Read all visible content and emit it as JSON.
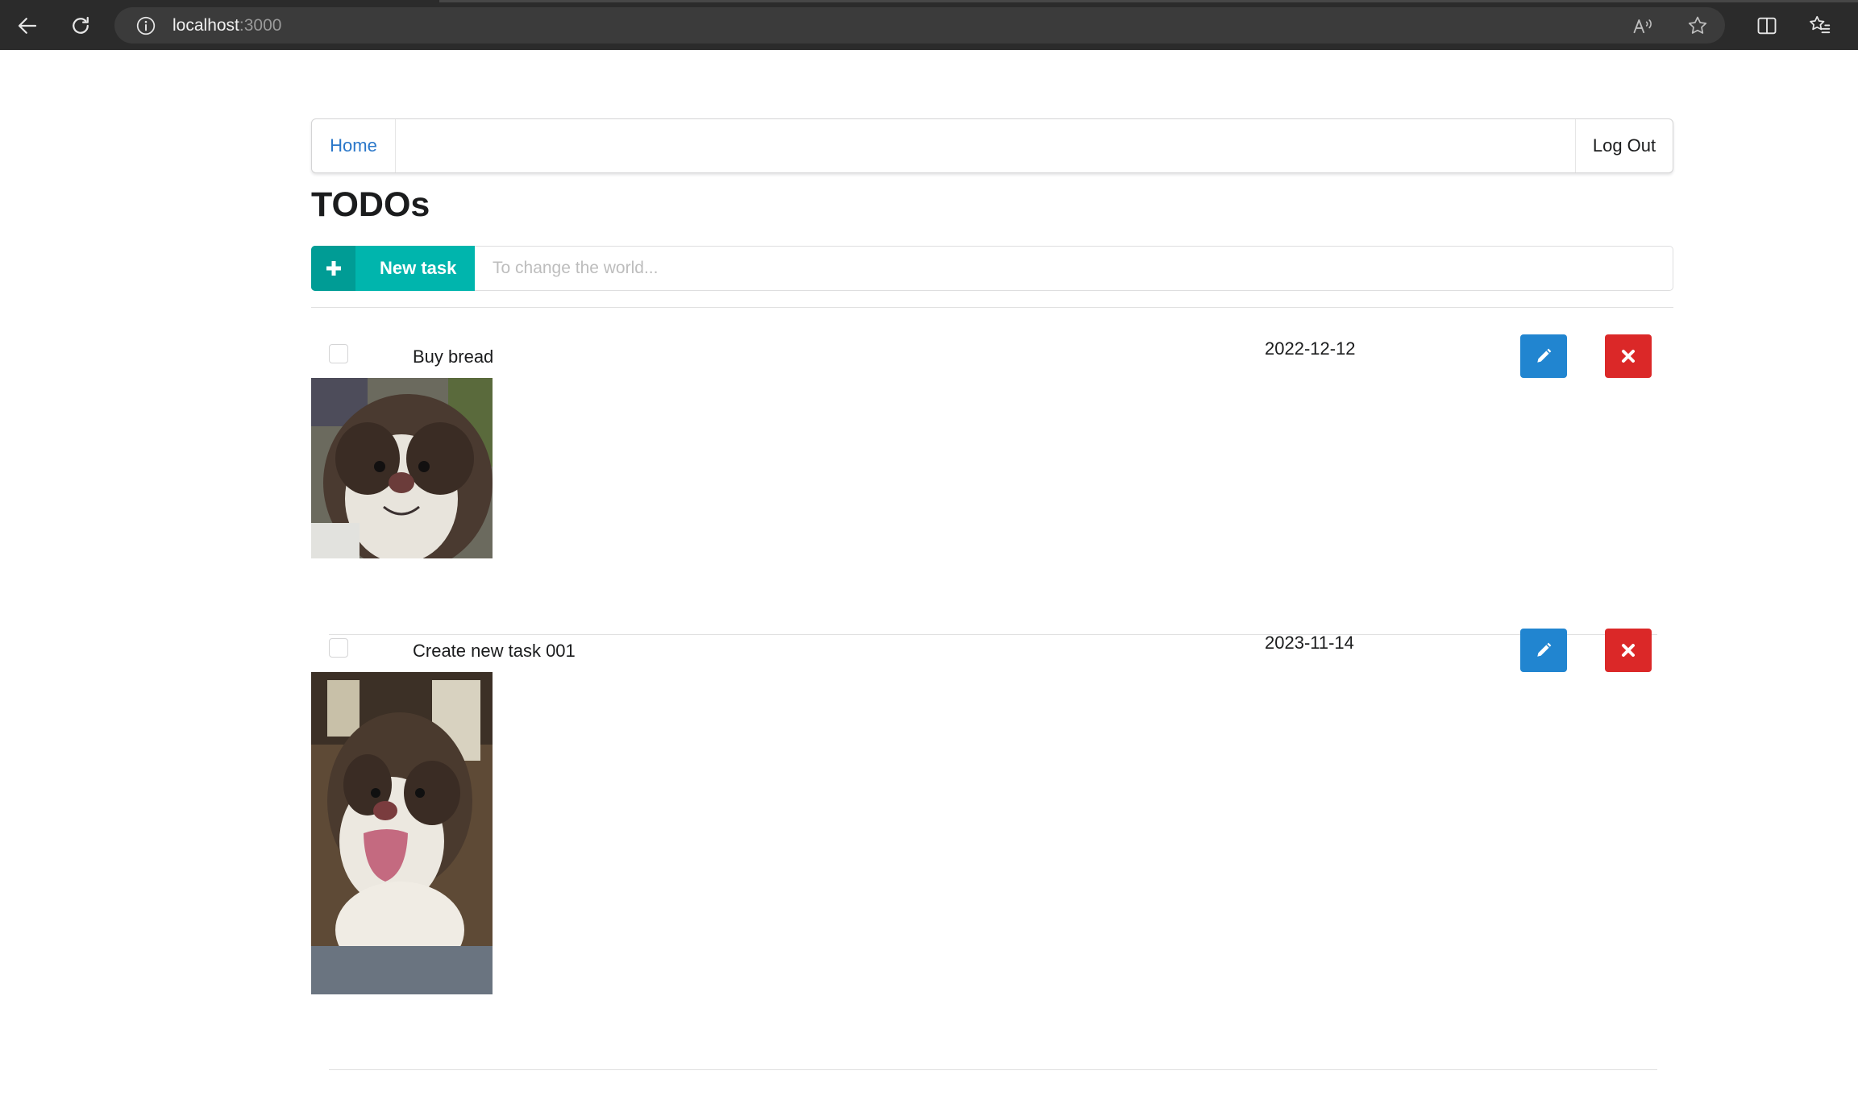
{
  "browser": {
    "url_host": "localhost",
    "url_port": ":3000"
  },
  "nav": {
    "home_label": "Home",
    "logout_label": "Log Out"
  },
  "page_title": "TODOs",
  "new_task": {
    "button_label": "New task",
    "placeholder": "To change the world..."
  },
  "colors": {
    "teal": "#00b5ad",
    "blue": "#2185d0",
    "red": "#db2828",
    "link": "#2a77c9"
  },
  "items": [
    {
      "name": "Buy bread",
      "date": "2022-12-12",
      "checked": false,
      "photo": "dog-photo"
    },
    {
      "name": "Create new task 001",
      "date": "2023-11-14",
      "checked": false,
      "photo": "dog-photo"
    }
  ]
}
